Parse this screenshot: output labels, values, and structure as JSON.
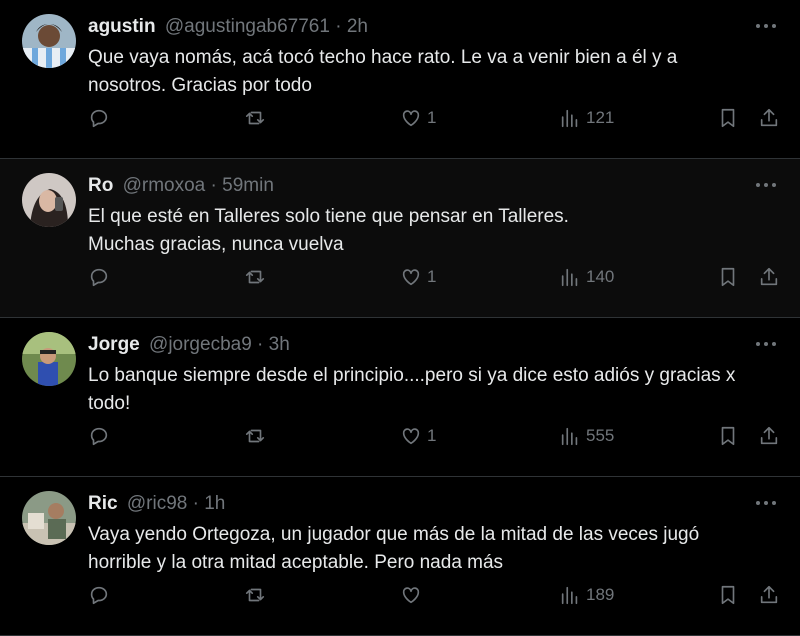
{
  "colors": {
    "background": "#000000",
    "text": "#e7e9ea",
    "muted": "#71767b",
    "divider": "#2f3336"
  },
  "tweets": [
    {
      "name": "agustin",
      "handle": "@agustingab67761 · 2h",
      "text": "Que vaya nomás, acá tocó techo hace rato. Le va a venir bien a él y a nosotros. Gracias por todo",
      "likes": "1",
      "views": "121",
      "icons": [
        "reply-icon",
        "retweet-icon",
        "like-icon",
        "views-icon",
        "bookmark-icon",
        "share-icon"
      ]
    },
    {
      "name": "Ro",
      "handle": "@rmoxoa · 59min",
      "text_lines": [
        "El que esté en Talleres solo tiene que pensar en Talleres.",
        "Muchas gracias, nunca vuelva"
      ],
      "likes": "1",
      "views": "140"
    },
    {
      "name": "Jorge",
      "handle": "@jorgecba9 · 3h",
      "text": "Lo banque siempre desde el principio....pero si ya dice esto adiós y gracias x todo!",
      "likes": "1",
      "views": "555"
    },
    {
      "name": "Ric",
      "handle": "@ric98 · 1h",
      "text": "Vaya yendo Ortegoza, un jugador que más de la mitad de las veces jugó horrible y la otra mitad aceptable. Pero nada más",
      "likes": "",
      "views": "189"
    }
  ]
}
